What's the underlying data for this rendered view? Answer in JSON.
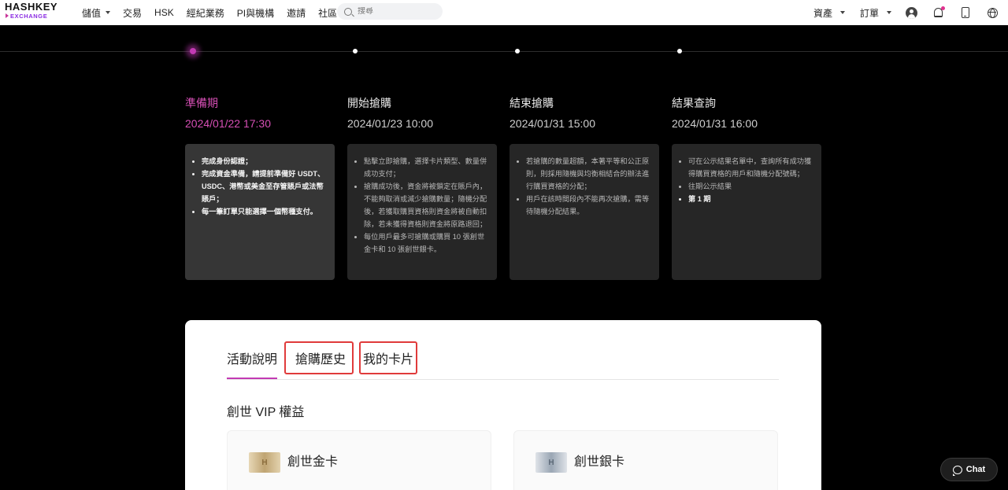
{
  "header": {
    "logo_top": "HASHKEY",
    "logo_bottom": "EXCHANGE",
    "nav": [
      {
        "label": "儲值",
        "has_caret": true
      },
      {
        "label": "交易",
        "has_caret": false
      },
      {
        "label": "HSK",
        "has_caret": false
      },
      {
        "label": "經紀業務",
        "has_caret": false
      },
      {
        "label": "PI與機構",
        "has_caret": false
      },
      {
        "label": "邀請",
        "has_caret": false
      },
      {
        "label": "社區",
        "has_caret": false
      }
    ],
    "search_placeholder": "搜尋",
    "assets_label": "資產",
    "orders_label": "訂單",
    "icons": [
      "user-icon",
      "bell-icon",
      "phone-icon",
      "globe-icon"
    ]
  },
  "timeline": {
    "phases": [
      {
        "title": "準備期",
        "date": "2024/01/22 17:30",
        "active": true,
        "items": [
          "完成身份認證；",
          "完成資金準備，請提前準備好 USDT、USDC、港幣或美金至存管賬戶或法幣賬戶；",
          "每一筆訂單只能選擇一個幣種支付。"
        ]
      },
      {
        "title": "開始搶購",
        "date": "2024/01/23 10:00",
        "active": false,
        "items": [
          "點擊立即搶購，選擇卡片類型、數量併成功支付；",
          "搶購成功後，資金將被鎖定在賬戶內，不能夠取消或減少搶購數量；隨機分配後，若獲取購買資格則資金將被自動扣除，若未獲得資格則資金將原路退回；",
          "每位用戶最多可搶購或購買 10 張創世金卡和 10 張創世銀卡。"
        ]
      },
      {
        "title": "結束搶購",
        "date": "2024/01/31 15:00",
        "active": false,
        "items": [
          "若搶購的數量超額，本著平等和公正原則，則採用隨機與均衡相結合的辦法進行購買資格的分配；",
          "用戶在該時間段內不能再次搶購，需等待隨機分配結果。"
        ]
      },
      {
        "title": "結果查詢",
        "date": "2024/01/31 16:00",
        "active": false,
        "items": [
          "可在公示結果名單中，查詢所有成功獲得購買資格的用戶和隨機分配號碼；",
          "往期公示結果",
          "第 1 期"
        ]
      }
    ]
  },
  "panel": {
    "tabs": [
      {
        "label": "活動說明",
        "active": true
      },
      {
        "label": "搶購歷史",
        "active": false
      },
      {
        "label": "我的卡片",
        "active": false
      }
    ],
    "section_title": "創世 VIP 權益",
    "cards": [
      {
        "name": "創世金卡",
        "thumb_text": "H",
        "variant": "gold"
      },
      {
        "name": "創世銀卡",
        "thumb_text": "H",
        "variant": "silver"
      }
    ]
  },
  "chat": {
    "label": "Chat"
  },
  "colors": {
    "accent": "#c23ab3",
    "highlight_box": "#e03b3b"
  }
}
